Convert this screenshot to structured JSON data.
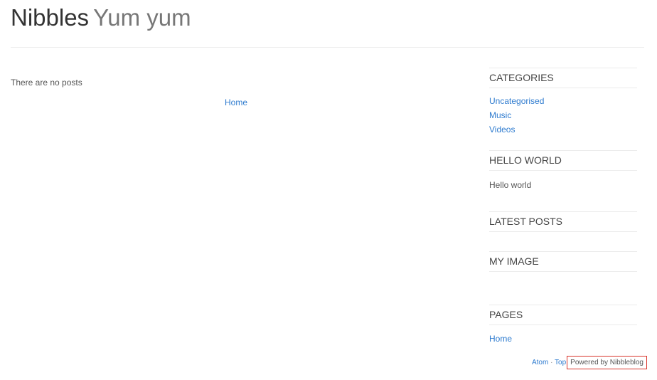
{
  "header": {
    "site_name": "Nibbles",
    "slogan": "Yum yum"
  },
  "main": {
    "no_posts_text": "There are no posts",
    "pager_home": "Home"
  },
  "sidebar": {
    "categories": {
      "title": "CATEGORIES",
      "items": [
        "Uncategorised",
        "Music",
        "Videos"
      ]
    },
    "hello_world": {
      "title": "HELLO WORLD",
      "text": "Hello world"
    },
    "latest_posts": {
      "title": "LATEST POSTS"
    },
    "my_image": {
      "title": "MY IMAGE"
    },
    "pages": {
      "title": "PAGES",
      "items": [
        "Home"
      ]
    }
  },
  "footer": {
    "atom": "Atom",
    "separator": "·",
    "top": "Top",
    "powered_by": "Powered by Nibbleblog"
  },
  "colors": {
    "link": "#2e7bcf",
    "highlight_box": "#d9342b"
  }
}
